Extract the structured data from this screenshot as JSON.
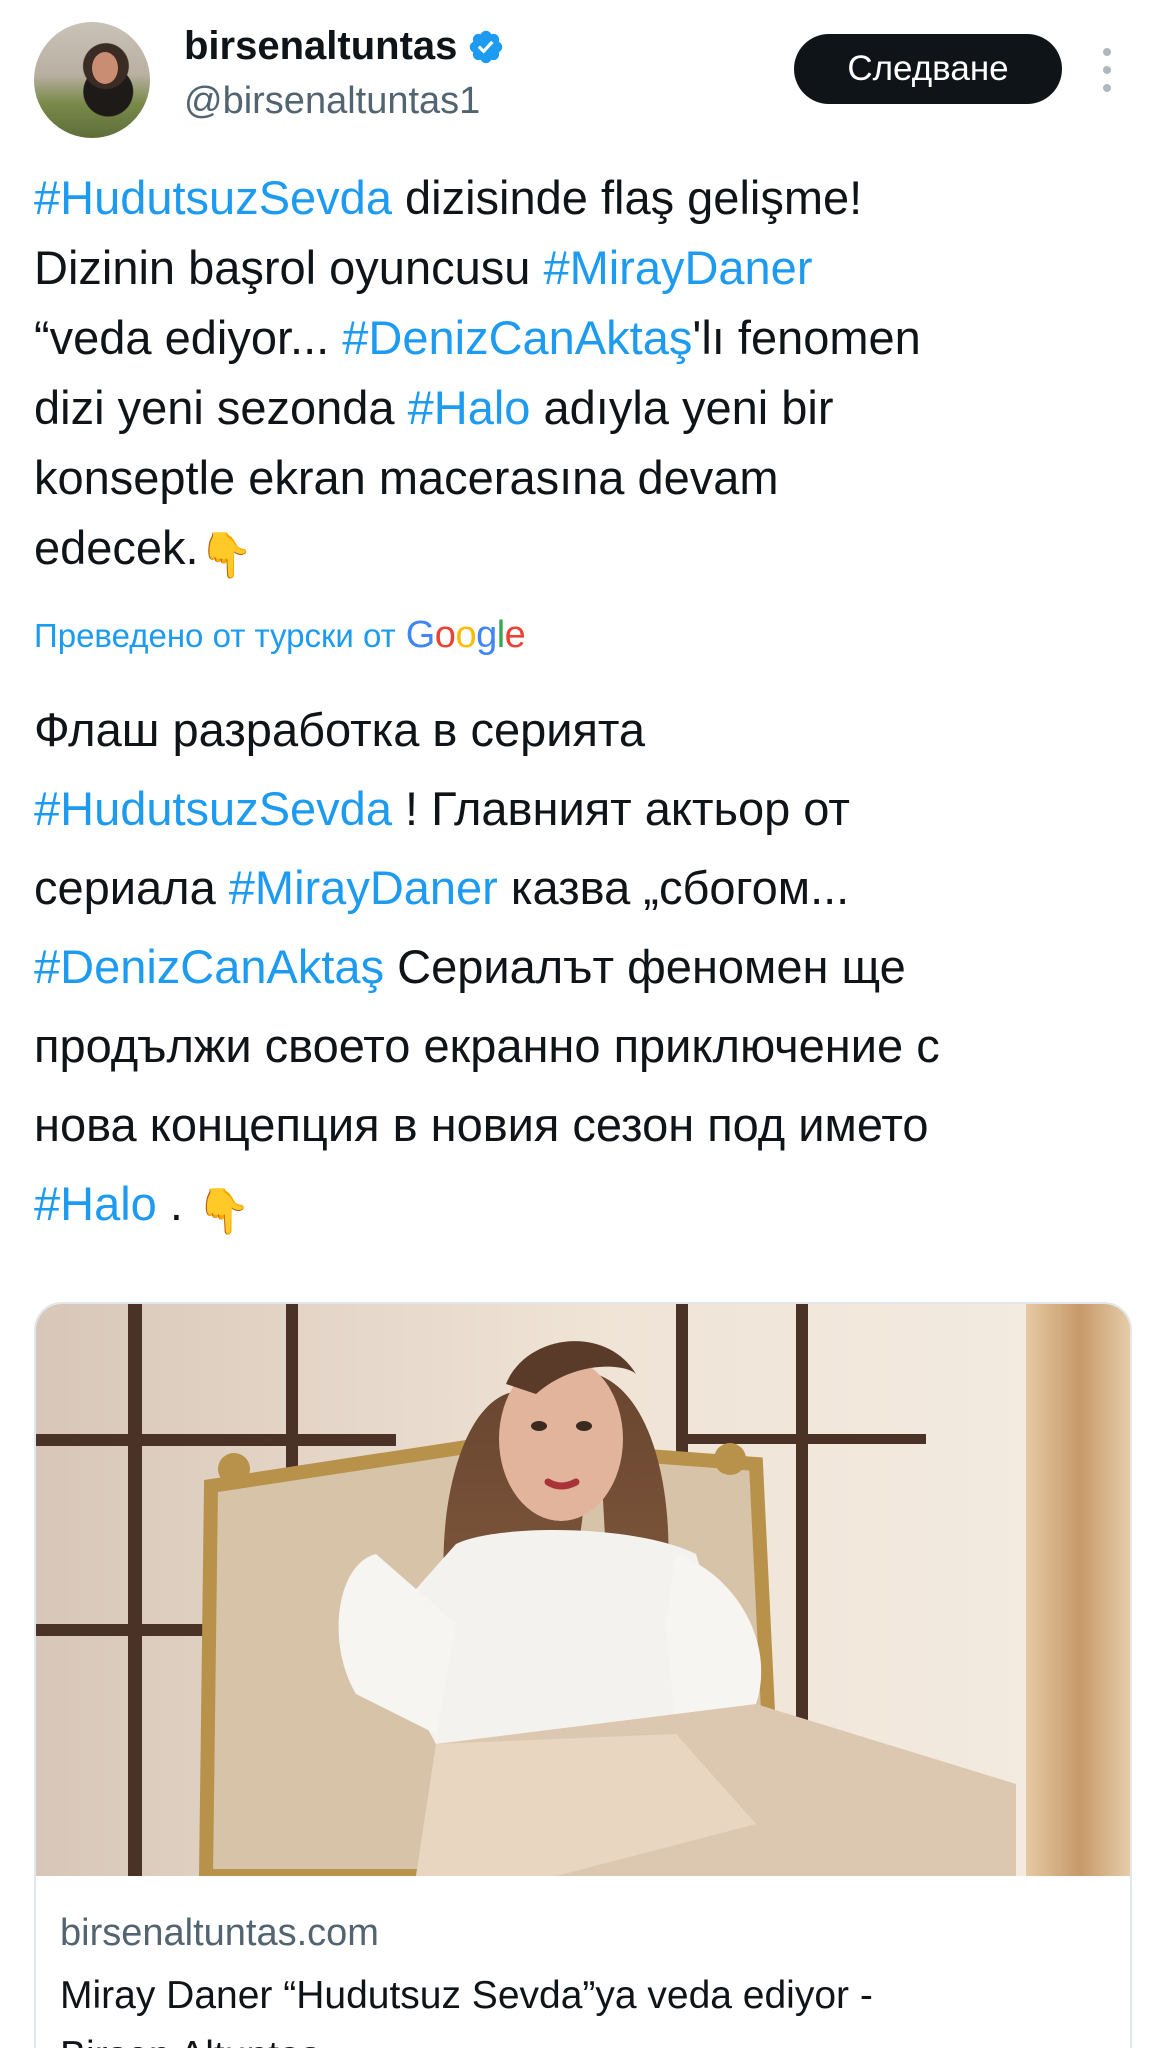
{
  "author": {
    "display_name": "birsenaltuntas",
    "handle": "@birsenaltuntas1",
    "verified_color": "#1d9bf0",
    "avatar_icon": "profile-photo"
  },
  "actions": {
    "follow_label": "Следване",
    "more_icon": "vertical-ellipsis-icon"
  },
  "tweet": {
    "tag_color": "#1d9bf0",
    "lines": [
      {
        "t1": "#HudutsuzSevda",
        "t2": " dizisinde flaş gelişme!"
      },
      {
        "t1": "Dizinin başrol oyuncusu ",
        "t2": "#MirayDaner"
      },
      {
        "t1": "“veda ediyor... ",
        "t2": "#DenizCanAktaş",
        "t3": "'lı fenomen"
      },
      {
        "t1": "dizi yeni sezonda ",
        "t2": "#Halo",
        "t3": " adıyla yeni bir"
      },
      {
        "t1": "konseptle ekran macerasına devam"
      },
      {
        "t1": "edecek.",
        "emoji": "👇"
      }
    ]
  },
  "translation": {
    "note": "Преведено от турски от",
    "provider": "Google"
  },
  "translated": {
    "lines": [
      {
        "t1": "Флаш разработка в серията"
      },
      {
        "t1": "#HudutsuzSevda",
        "t2": " ! Главният актьор от"
      },
      {
        "t1": "сериала ",
        "t2": "#MirayDaner",
        "t3": " казва „сбогом..."
      },
      {
        "t1": "#DenizCanAktaş",
        "t2": " Сериалът феномен ще"
      },
      {
        "t1": "продължи своето екранно приключение с"
      },
      {
        "t1": "нова концепция в новия сезон под името"
      },
      {
        "t1": "#Halo",
        "t2": " . ",
        "emoji": "👇"
      }
    ]
  },
  "link_card": {
    "domain": "birsenaltuntas.com",
    "title": "Miray Daner “Hudutsuz Sevda”ya veda ediyor -",
    "title_cont": "Birsen Altuntas"
  }
}
